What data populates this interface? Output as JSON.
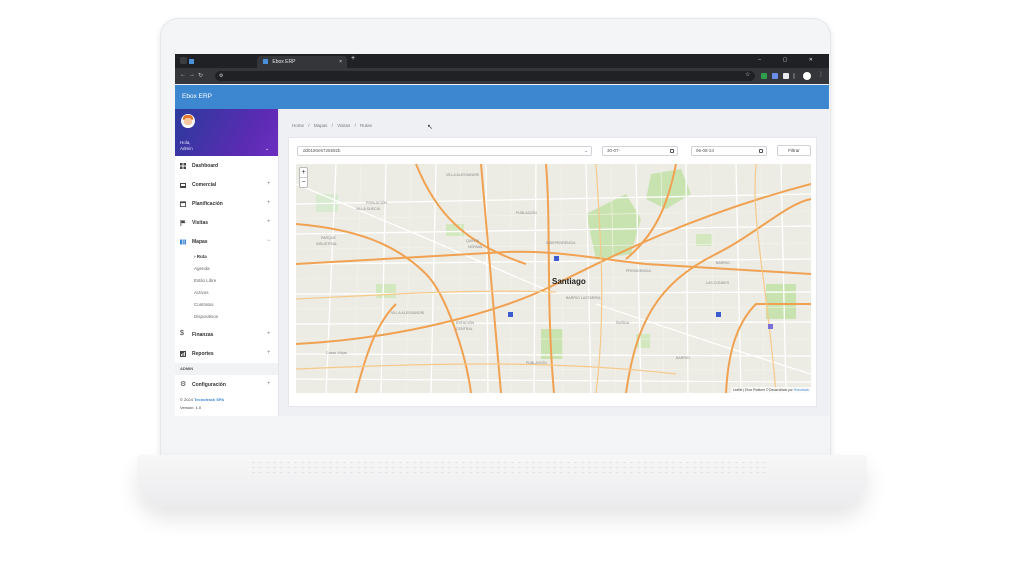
{
  "browser": {
    "tab_title": "Ebox ERP",
    "tab_close": "×",
    "new_tab": "+",
    "window_controls": "− ▢ ✕"
  },
  "app": {
    "title": "Ebox ERP"
  },
  "user": {
    "greeting": "Hola,",
    "name": "Admin"
  },
  "sidebar": {
    "items": [
      {
        "label": "Dashboard",
        "icon": "dashboard-icon",
        "has_plus": false
      },
      {
        "label": "Comercial",
        "icon": "store-icon",
        "has_plus": true
      },
      {
        "label": "Planificación",
        "icon": "calendar-icon",
        "has_plus": true
      },
      {
        "label": "Visitas",
        "icon": "flag-icon",
        "has_plus": true
      },
      {
        "label": "Mapas",
        "icon": "map-icon",
        "expanded": true
      }
    ],
    "submenu": [
      {
        "label": "Ruta",
        "active": true
      },
      {
        "label": "Agenda"
      },
      {
        "label": "Estilo Libre"
      },
      {
        "label": "Activos"
      },
      {
        "label": "Contratos"
      },
      {
        "label": "Dispositivos"
      }
    ],
    "items_after": [
      {
        "label": "Finanzas",
        "icon": "dollar-icon"
      },
      {
        "label": "Reportes",
        "icon": "chart-icon"
      }
    ],
    "section_admin": "ADMIN",
    "config": {
      "label": "Configuración",
      "icon": "gear-icon"
    },
    "footer_copyright_prefix": "© 2024",
    "footer_company": "Tecnotrack SPA",
    "footer_version_label": "Version:",
    "footer_version": "1.0",
    "plus": "+",
    "minus": "−",
    "chevron": "⌄",
    "submenu_marker": "›"
  },
  "breadcrumb": [
    "Home",
    "/",
    "Mapas",
    "/",
    "Visitas",
    "/",
    "Rutas"
  ],
  "filters": {
    "device_value": "dd0180e6725592b",
    "date_from": "30-07-",
    "date_to": "06-08-24",
    "filter_label": "Filtrar"
  },
  "map": {
    "city": "Santiago",
    "zoom_in": "+",
    "zoom_out": "−",
    "attribution_prefix": "Leaflet | Ebox Platform ©",
    "attribution_mid": "Desarrollado por",
    "attribution_company": "Tecnotrack",
    "colors": {
      "road_major": "#f0a252",
      "road_minor": "#ffffff",
      "park": "#c8e3b0",
      "land": "#ecebe4"
    }
  },
  "colors": {
    "header": "#3d86d0",
    "sidebar_gradient_start": "#2b3b9c",
    "sidebar_gradient_end": "#6c2fc1"
  }
}
